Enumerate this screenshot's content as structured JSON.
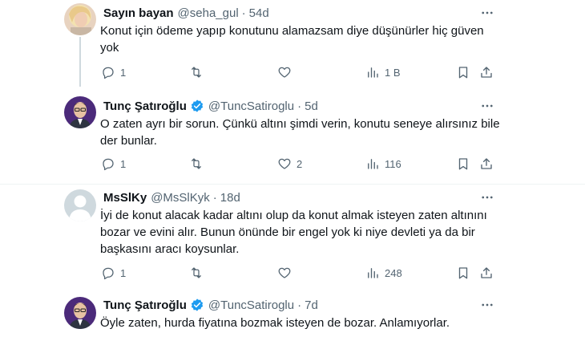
{
  "tweets": [
    {
      "name": "Sayın bayan",
      "handle": "@seha_gul",
      "separator": "·",
      "time": "54d",
      "verified": false,
      "text": "Konut için ödeme yapıp konutunu alamazsam diye düşünürler hiç güven yok",
      "replies": "1",
      "retweets": "",
      "likes": "",
      "views": "1 B"
    },
    {
      "name": "Tunç Şatıroğlu",
      "handle": "@TuncSatiroglu",
      "separator": "·",
      "time": "5d",
      "verified": true,
      "text": "O zaten ayrı bir sorun. Çünkü altını şimdi verin, konutu seneye alırsınız bile der bunlar.",
      "replies": "1",
      "retweets": "",
      "likes": "2",
      "views": "116"
    },
    {
      "name": "MsSlKy",
      "handle": "@MsSlKyk",
      "separator": "·",
      "time": "18d",
      "verified": false,
      "text": "İyi de konut alacak kadar altını olup da konut almak isteyen zaten altınını bozar ve evini alır. Bunun önünde bir engel yok ki niye devleti ya da bir başkasını aracı koysunlar.",
      "replies": "1",
      "retweets": "",
      "likes": "",
      "views": "248"
    },
    {
      "name": "Tunç Şatıroğlu",
      "handle": "@TuncSatiroglu",
      "separator": "·",
      "time": "7d",
      "verified": true,
      "text": "Öyle zaten, hurda fiyatına bozmak isteyen de bozar. Anlamıyorlar."
    }
  ],
  "colors": {
    "verified": "#1d9bf0",
    "secondary_text": "#536471",
    "thread_line": "#cfd9de"
  },
  "icons": [
    "more-icon",
    "reply-icon",
    "retweet-icon",
    "like-icon",
    "views-icon",
    "bookmark-icon",
    "share-icon",
    "verified-icon"
  ]
}
